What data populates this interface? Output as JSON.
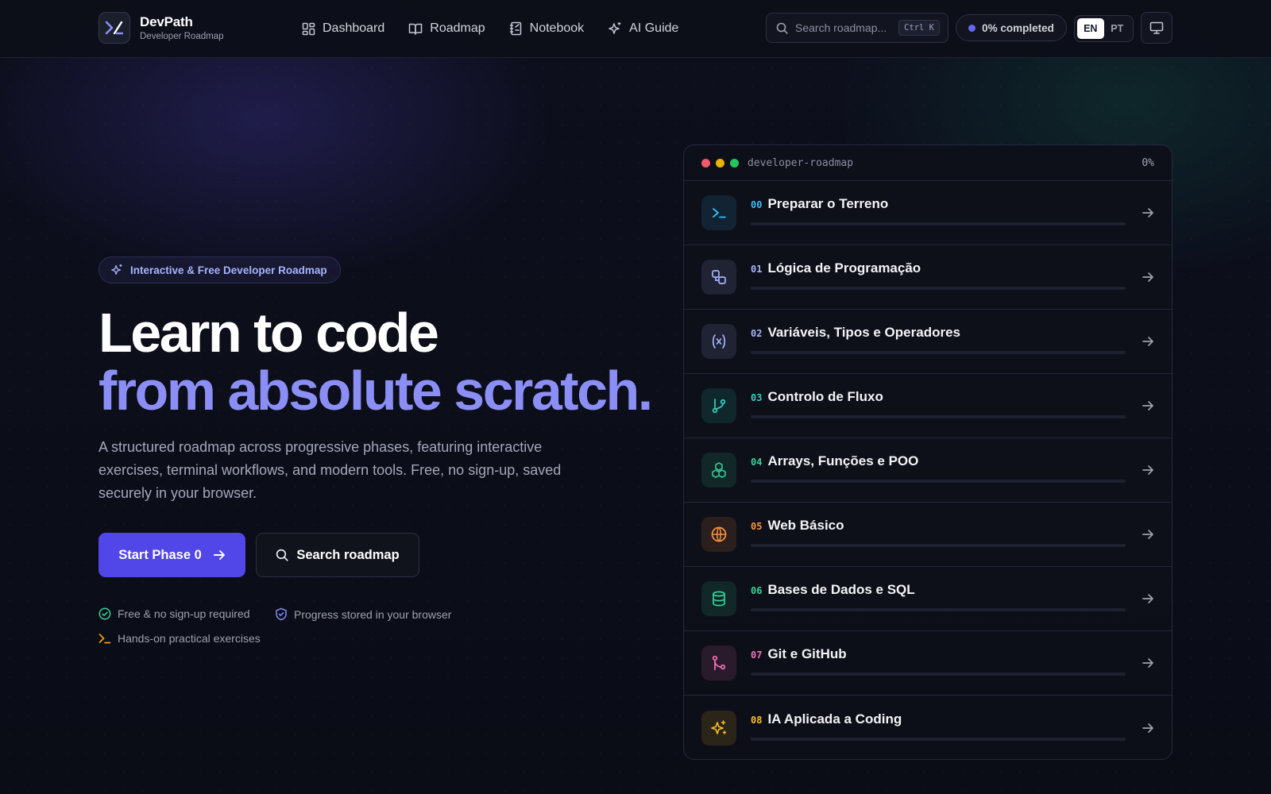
{
  "brand": {
    "name": "DevPath",
    "subtitle": "Developer Roadmap"
  },
  "nav": {
    "items": [
      {
        "label": "Dashboard",
        "icon": "dashboard-icon"
      },
      {
        "label": "Roadmap",
        "icon": "book-icon"
      },
      {
        "label": "Notebook",
        "icon": "notebook-icon"
      },
      {
        "label": "AI Guide",
        "icon": "sparkles-icon"
      }
    ]
  },
  "search": {
    "placeholder": "Search roadmap...",
    "shortcut": "Ctrl K"
  },
  "progress": {
    "label": "0% completed",
    "value": 0
  },
  "language": {
    "options": [
      "EN",
      "PT"
    ],
    "selected": "EN"
  },
  "hero": {
    "badge": "Interactive & Free Developer Roadmap",
    "headline_line1": "Learn to code",
    "headline_line2": "from absolute scratch.",
    "description": "A structured roadmap across progressive phases, featuring interactive exercises, terminal workflows, and modern tools. Free, no sign-up, saved securely in your browser.",
    "primary_button": "Start Phase 0",
    "secondary_button": "Search roadmap",
    "features": [
      "Free & no sign-up required",
      "Progress stored in your browser",
      "Hands-on practical exercises"
    ]
  },
  "panel": {
    "title": "developer-roadmap",
    "percent": "0%",
    "phases": [
      {
        "num": "00",
        "name": "Preparar o Terreno",
        "icon": "terminal-icon",
        "color": "#38bdf8",
        "progress": 0
      },
      {
        "num": "01",
        "name": "Lógica de Programação",
        "icon": "flowchart-icon",
        "color": "#a5b4fc",
        "progress": 0
      },
      {
        "num": "02",
        "name": "Variáveis, Tipos e Operadores",
        "icon": "variable-icon",
        "color": "#a5b4fc",
        "progress": 0
      },
      {
        "num": "03",
        "name": "Controlo de Fluxo",
        "icon": "git-branch-icon",
        "color": "#2dd4bf",
        "progress": 0
      },
      {
        "num": "04",
        "name": "Arrays, Funções e POO",
        "icon": "boxes-icon",
        "color": "#34d399",
        "progress": 0
      },
      {
        "num": "05",
        "name": "Web Básico",
        "icon": "globe-icon",
        "color": "#fb923c",
        "progress": 0
      },
      {
        "num": "06",
        "name": "Bases de Dados e SQL",
        "icon": "database-icon",
        "color": "#34d399",
        "progress": 0
      },
      {
        "num": "07",
        "name": "Git e GitHub",
        "icon": "git-merge-icon",
        "color": "#f472b6",
        "progress": 0
      },
      {
        "num": "08",
        "name": "IA Aplicada a Coding",
        "icon": "sparkles-icon",
        "color": "#fbbf24",
        "progress": 0
      }
    ]
  }
}
